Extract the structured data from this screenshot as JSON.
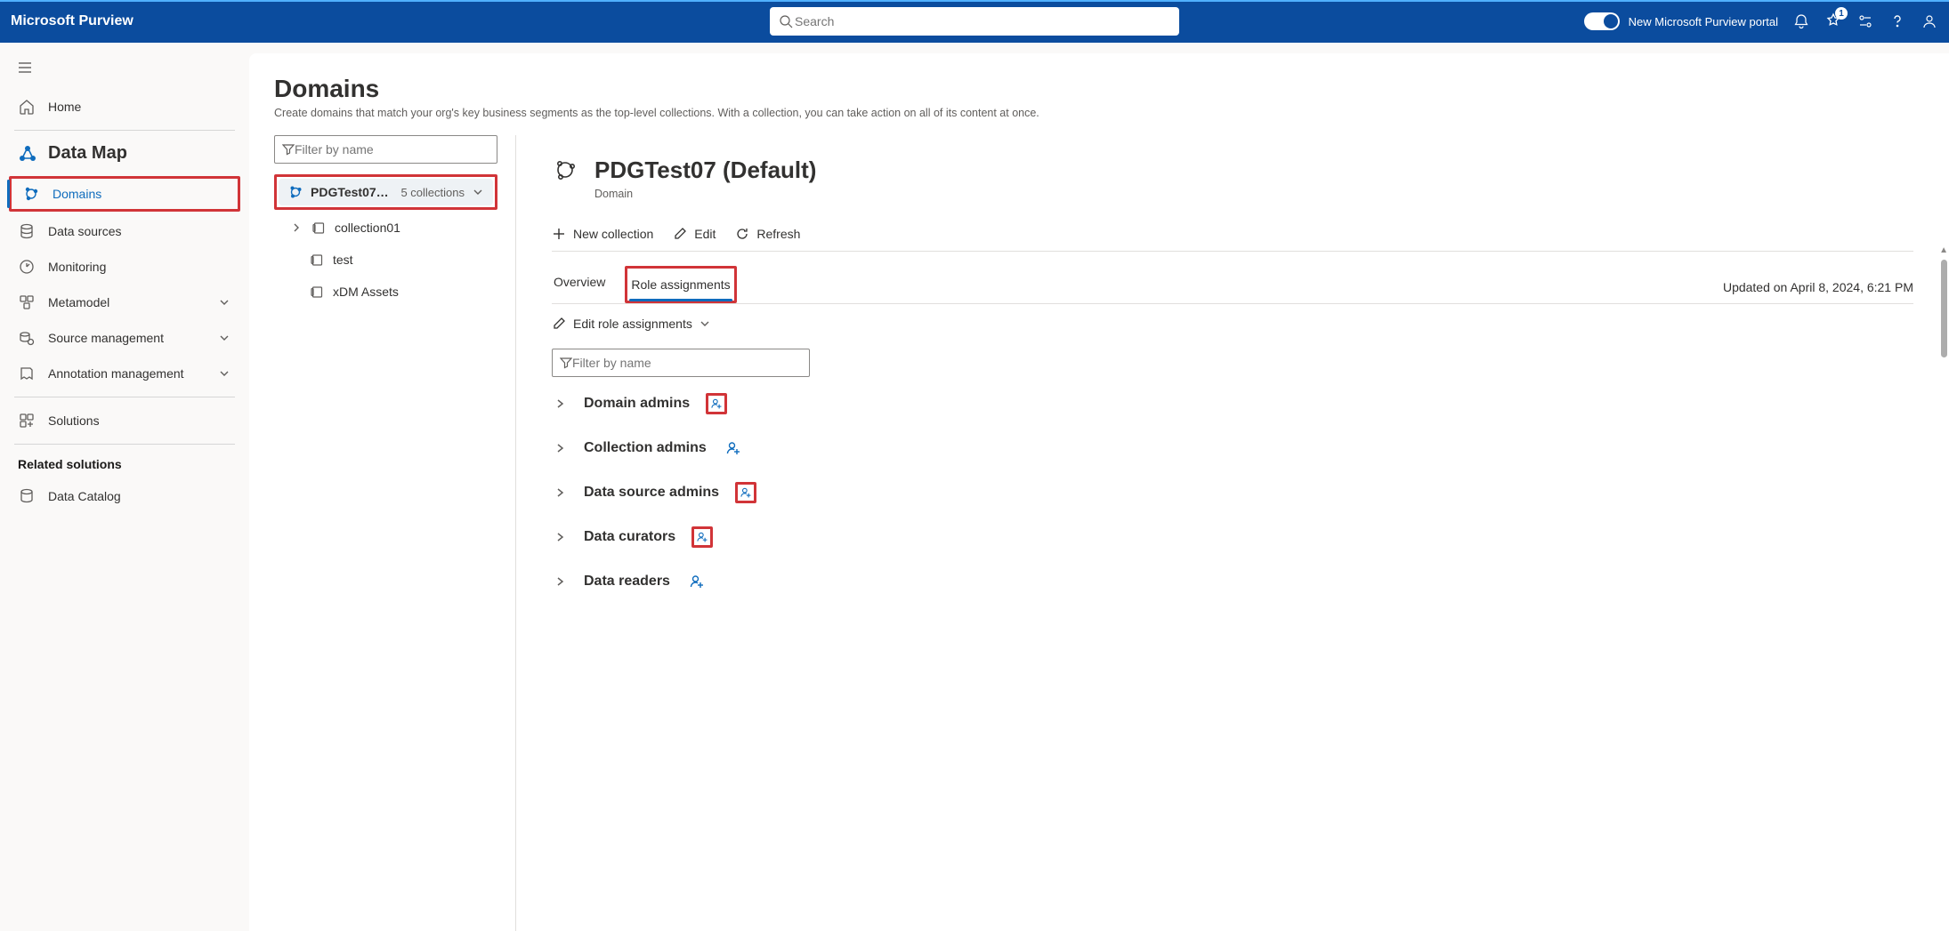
{
  "header": {
    "brand": "Microsoft Purview",
    "search_placeholder": "Search",
    "new_portal_label": "New Microsoft Purview portal",
    "notification_badge": "1"
  },
  "sidebar": {
    "home_label": "Home",
    "section_title": "Data Map",
    "items": [
      {
        "label": "Domains",
        "active": true,
        "highlight": true
      },
      {
        "label": "Data sources"
      },
      {
        "label": "Monitoring"
      },
      {
        "label": "Metamodel",
        "expandable": true
      },
      {
        "label": "Source management",
        "expandable": true
      },
      {
        "label": "Annotation management",
        "expandable": true
      }
    ],
    "solutions_label": "Solutions",
    "related_header": "Related solutions",
    "related_items": [
      {
        "label": "Data Catalog"
      }
    ]
  },
  "page": {
    "title": "Domains",
    "subtitle": "Create domains that match your org's key business segments as the top-level collections. With a collection, you can take action on all of its content at once."
  },
  "tree": {
    "filter_placeholder": "Filter by name",
    "root_label": "PDGTest07 (De…",
    "root_count": "5 collections",
    "children": [
      {
        "label": "collection01",
        "has_children": true
      },
      {
        "label": "test",
        "has_children": false
      },
      {
        "label": "xDM Assets",
        "has_children": false
      }
    ]
  },
  "detail": {
    "title": "PDGTest07 (Default)",
    "kind": "Domain",
    "commands": {
      "new_collection": "New collection",
      "edit": "Edit",
      "refresh": "Refresh"
    },
    "tabs": {
      "overview": "Overview",
      "role_assignments": "Role assignments"
    },
    "updated_text": "Updated on April 8, 2024, 6:21 PM",
    "edit_roles_label": "Edit role assignments",
    "role_filter_placeholder": "Filter by name",
    "roles": [
      {
        "label": "Domain admins",
        "highlight": true
      },
      {
        "label": "Collection admins",
        "highlight": false
      },
      {
        "label": "Data source admins",
        "highlight": true
      },
      {
        "label": "Data curators",
        "highlight": true
      },
      {
        "label": "Data readers",
        "highlight": false
      }
    ]
  }
}
